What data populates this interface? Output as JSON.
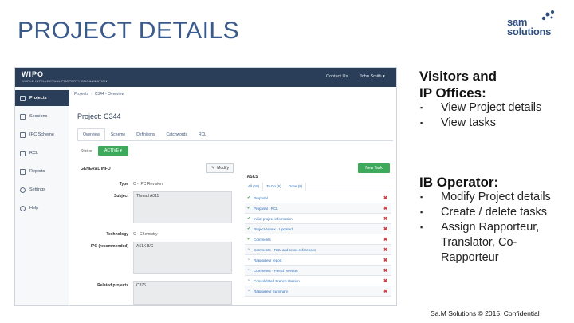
{
  "slide": {
    "title": "PROJECT DETAILS",
    "logo": {
      "line1": "sam",
      "line2": "solutions"
    },
    "footer": "Sa.M Solutions © 2015. Confidential"
  },
  "colors": {
    "title": "#3b5a8c",
    "app_header": "#2b3e59",
    "success": "#3daa5b",
    "danger": "#d13c3c",
    "link": "#2f6fb8"
  },
  "screenshot": {
    "brand": "WIPO",
    "brand_sub": "WORLD INTELLECTUAL PROPERTY ORGANIZATION",
    "topnav": {
      "contact": "Contact Us",
      "user": "John Smith ▾"
    },
    "sidebar": [
      {
        "label": "Projects",
        "icon": "projects-icon"
      },
      {
        "label": "Sessions",
        "icon": "sessions-icon"
      },
      {
        "label": "IPC Scheme",
        "icon": "scheme-icon"
      },
      {
        "label": "RCL",
        "icon": "rcl-icon"
      },
      {
        "label": "Reports",
        "icon": "reports-icon"
      },
      {
        "label": "Settings",
        "icon": "gear-icon"
      },
      {
        "label": "Help",
        "icon": "help-icon"
      }
    ],
    "breadcrumb": [
      "Projects",
      "C344 - Overview"
    ],
    "project_title": "Project: C344",
    "tabs": [
      "Overview",
      "Scheme",
      "Definitions",
      "Catchwords",
      "RCL"
    ],
    "status_label": "Status:",
    "status_value": "ACTIVE ▾",
    "general_info": "GENERAL INFO",
    "modify_label": "Modify",
    "fields": {
      "type_label": "Type",
      "type_value": "C - IPC Revision",
      "subject_label": "Subject",
      "subject_value": "Thread A011",
      "technology_label": "Technology",
      "technology_value": "C - Chemistry",
      "ipc_label": "IPC (recommended)",
      "ipc_value": "A61K 8/C",
      "related_label": "Related projects",
      "related_value": "C376"
    },
    "tasks": {
      "title": "TASKS",
      "new_task": "New Task",
      "filters": [
        "All (18)",
        "To Do (6)",
        "Done (9)"
      ],
      "items": [
        {
          "label": "Proposal",
          "icon": "check"
        },
        {
          "label": "Proposal - RCL",
          "icon": "check"
        },
        {
          "label": "Initial project information",
          "icon": "check"
        },
        {
          "label": "Project Annex - Updated",
          "icon": "check"
        },
        {
          "label": "Comments",
          "icon": "check"
        },
        {
          "label": "Comments - RCL and cross-references",
          "icon": "clock"
        },
        {
          "label": "Rapporteur report",
          "icon": "clock"
        },
        {
          "label": "Comments - French version",
          "icon": "clock"
        },
        {
          "label": "Consolidated French Version",
          "icon": "clock"
        },
        {
          "label": "Rapporteur Summary",
          "icon": "clock"
        }
      ]
    }
  },
  "visitors": {
    "heading_line1": "Visitors and",
    "heading_line2": "IP Offices:",
    "bullets": [
      "View Project details",
      "View tasks"
    ]
  },
  "operator": {
    "heading": "IB Operator:",
    "bullets": [
      "Modify Project details",
      "Create / delete tasks",
      "Assign Rapporteur,",
      "Translator, Co-",
      "Rapporteur"
    ]
  }
}
